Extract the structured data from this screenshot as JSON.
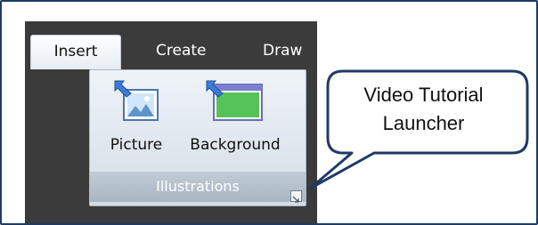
{
  "ribbon": {
    "tabs": [
      {
        "label": "Insert",
        "active": true
      },
      {
        "label": "Create",
        "active": false
      },
      {
        "label": "Draw",
        "active": false
      }
    ],
    "group": {
      "buttons": [
        {
          "label": "Picture",
          "icon": "picture-icon"
        },
        {
          "label": "Background",
          "icon": "background-icon"
        }
      ],
      "label": "Illustrations",
      "launcher_icon": "dialog-launcher-icon"
    }
  },
  "callout": {
    "text_line1": "Video Tutorial",
    "text_line2": "Launcher"
  },
  "colors": {
    "frame_border": "#1f3a66",
    "ribbon_dark": "#3b3b3b",
    "callout_border": "#1f3a66"
  }
}
